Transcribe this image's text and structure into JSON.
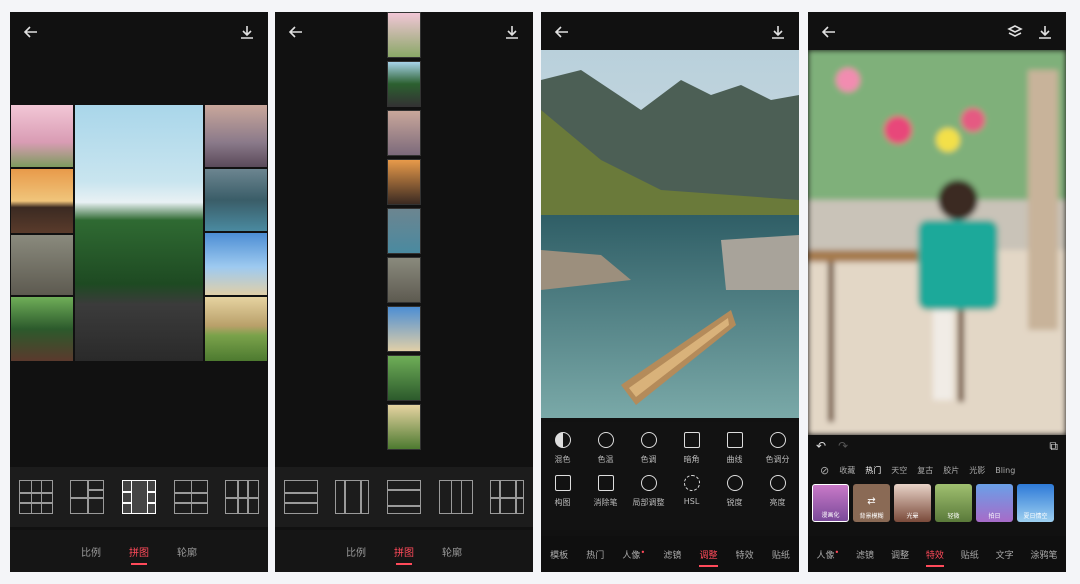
{
  "panel1": {
    "layout_tabs": [
      "比例",
      "拼图",
      "轮廓"
    ],
    "active_tab": "拼图"
  },
  "panel2": {
    "layout_tabs": [
      "比例",
      "拼图",
      "轮廓"
    ],
    "active_tab": "拼图"
  },
  "panel3": {
    "tools_row1": [
      "混色",
      "色温",
      "色调",
      "暗角",
      "曲线",
      "色调分"
    ],
    "tools_row2": [
      "构图",
      "消除笔",
      "局部调整",
      "HSL",
      "锐度",
      "亮度"
    ],
    "bottom_tabs": [
      "模板",
      "热门",
      "人像",
      "滤镜",
      "调整",
      "特效",
      "贴纸"
    ],
    "active_tab": "调整"
  },
  "panel4": {
    "categories": [
      "收藏",
      "热门",
      "天空",
      "复古",
      "胶片",
      "光影",
      "Bling"
    ],
    "active_category": "热门",
    "effects": [
      "漫画化",
      "背景模糊",
      "光晕",
      "轻微",
      "拍日",
      "夏日情空"
    ],
    "bottom_tabs": [
      "人像",
      "滤镜",
      "调整",
      "特效",
      "贴纸",
      "文字",
      "涂鸦笔"
    ],
    "active_tab": "特效"
  },
  "colors": {
    "accent": "#ff4a5a",
    "panel_bg": "#111111"
  }
}
